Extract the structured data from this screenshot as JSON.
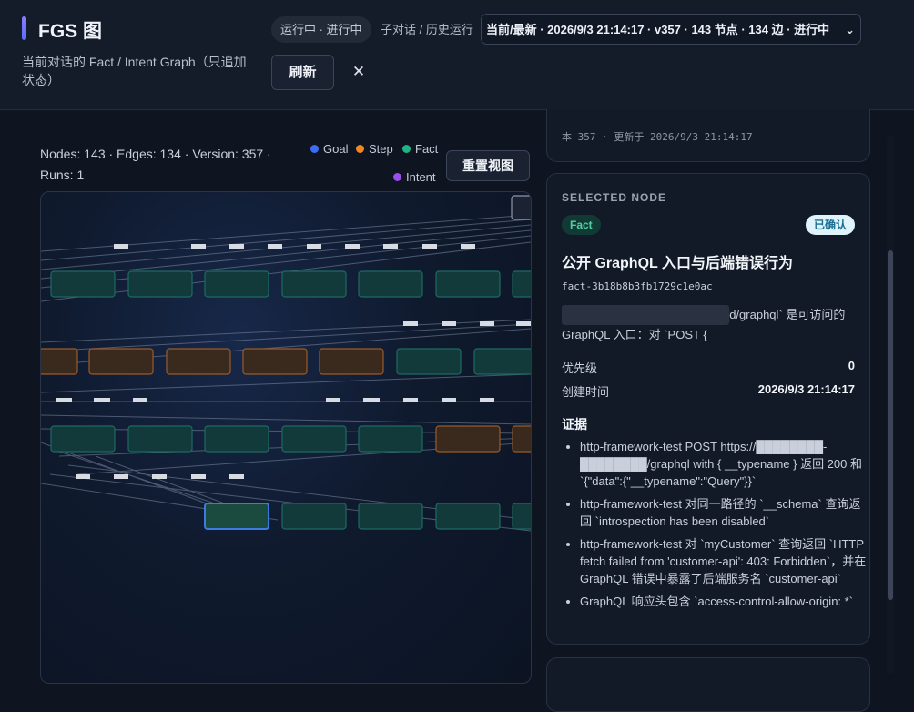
{
  "header": {
    "title": "FGS 图",
    "subtitle": "当前对话的 Fact / Intent Graph（只追加状态）",
    "status": "运行中 · 进行中",
    "crumb": "子对话 / 历史运行",
    "run_select": "当前/最新 · 2026/9/3 21:14:17 · v357 · 143 节点 · 134 边 · 进行中",
    "refresh_label": "刷新",
    "close_label": "✕"
  },
  "graph": {
    "stats": "Nodes: 143 · Edges: 134 · Version: 357 · Runs: 1",
    "legend": [
      {
        "label": "Goal",
        "color": "#3b6ef5"
      },
      {
        "label": "Step",
        "color": "#f0861e"
      },
      {
        "label": "Fact",
        "color": "#1fb486"
      },
      {
        "label": "Intent",
        "color": "#9b4ef0"
      }
    ],
    "reset_label": "重置视图"
  },
  "sidebar": {
    "top_meta": "本 357 · 更新于 2026/9/3 21:14:17",
    "section_label": "SELECTED NODE",
    "node": {
      "kind": "Fact",
      "state": "已确认",
      "title": "公开 GraphQL 入口与后端错误行为",
      "id": "fact-3b18b8b3fb1729c1e0ac",
      "desc_tail": "d/graphql` 是可访问的 GraphQL 入口：对 `POST {",
      "priority_label": "优先级",
      "priority_value": "0",
      "created_label": "创建时间",
      "created_value": "2026/9/3 21:14:17"
    },
    "evidence_title": "证据",
    "evidence": [
      "http-framework-test POST https://████████-████████/graphql with { __typename } 返回 200 和 `{\"data\":{\"__typename\":\"Query\"}}`",
      "http-framework-test 对同一路径的 `__schema` 查询返回 `introspection has been disabled`",
      "http-framework-test 对 `myCustomer` 查询返回 `HTTP fetch failed from 'customer-api': 403: Forbidden`，并在 GraphQL 错误中暴露了后端服务名 `customer-api`",
      "GraphQL 响应头包含 `access-control-allow-origin: *`"
    ]
  }
}
